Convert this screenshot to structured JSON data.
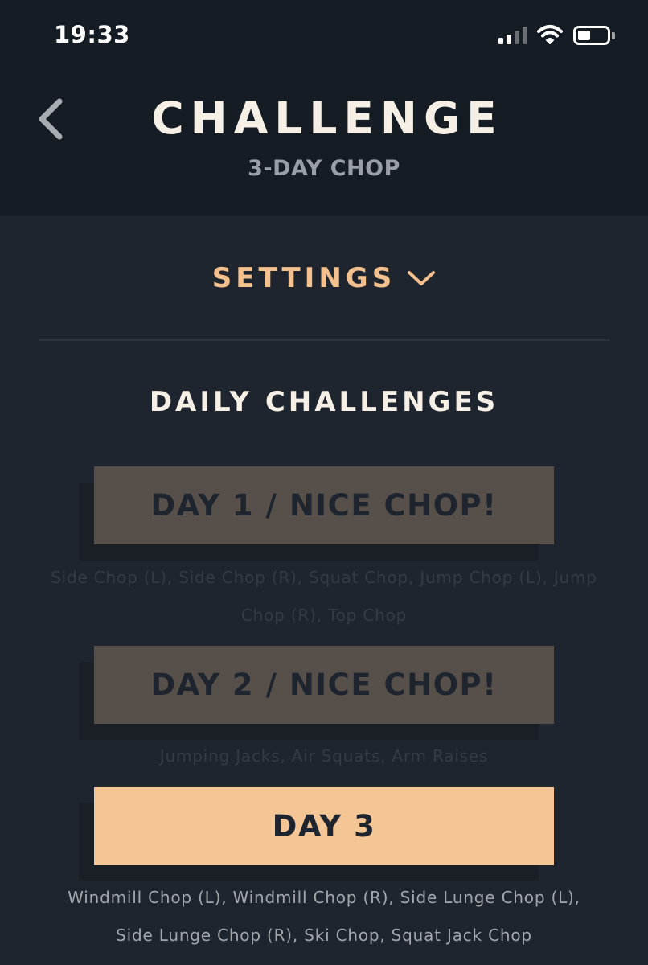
{
  "status_bar": {
    "time": "19:33"
  },
  "header": {
    "title": "CHALLENGE",
    "subtitle": "3-DAY CHOP"
  },
  "settings": {
    "label": "SETTINGS"
  },
  "section": {
    "title": "DAILY CHALLENGES"
  },
  "days": [
    {
      "label": "DAY 1 / NICE CHOP!",
      "state": "completed",
      "exercises": "Side Chop (L), Side Chop (R), Squat Chop, Jump Chop (L), Jump Chop (R), Top Chop"
    },
    {
      "label": "DAY 2 / NICE CHOP!",
      "state": "completed",
      "exercises": "Jumping Jacks, Air Squats, Arm Raises"
    },
    {
      "label": "DAY 3",
      "state": "active",
      "exercises": "Windmill Chop (L), Windmill Chop (R), Side Lunge Chop (L), Side Lunge Chop (R), Ski Chop, Squat Jack Chop"
    }
  ],
  "colors": {
    "header_bg": "#161c24",
    "body_bg": "#1f252e",
    "accent": "#f4c08e",
    "completed_btn": "#57504a",
    "active_btn": "#f4c595"
  },
  "icons": {
    "back": "chevron-left-icon",
    "settings_toggle": "chevron-down-icon",
    "signal": "cellular-signal-icon",
    "wifi": "wifi-icon",
    "battery": "battery-icon"
  }
}
